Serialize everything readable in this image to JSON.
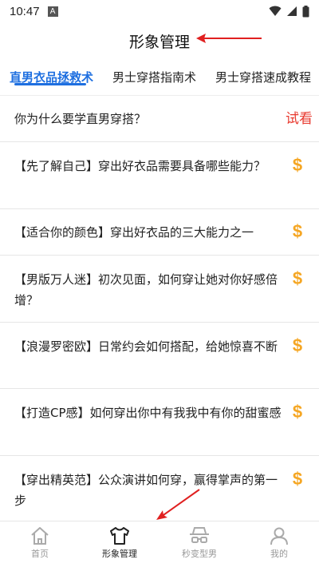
{
  "status_bar": {
    "time": "10:47",
    "notif_letter": "A"
  },
  "header": {
    "title": "形象管理"
  },
  "tabs": [
    {
      "label": "直男衣品拯救术",
      "active": true
    },
    {
      "label": "男士穿搭指南术",
      "active": false
    },
    {
      "label": "男士穿搭速成教程",
      "active": false
    }
  ],
  "intro": {
    "question": "你为什么要学直男穿搭？",
    "try_label": "试看"
  },
  "lessons": [
    {
      "text": "【先了解自己】穿出好衣品需要具备哪些能力？",
      "price_icon": "$"
    },
    {
      "text": "【适合你的颜色】穿出好衣品的三大能力之一",
      "price_icon": "$"
    },
    {
      "text": "【男版万人迷】初次见面，如何穿让她对你好感倍增？",
      "price_icon": "$"
    },
    {
      "text": "【浪漫罗密欧】日常约会如何搭配，给她惊喜不断",
      "price_icon": "$"
    },
    {
      "text": "【打造CP感】如何穿出你中有我我中有你的甜蜜感",
      "price_icon": "$"
    },
    {
      "text": "【穿出精英范】公众演讲如何穿，赢得掌声的第一步",
      "price_icon": "$"
    }
  ],
  "bottom_nav": [
    {
      "label": "首页",
      "icon": "home-icon",
      "active": false
    },
    {
      "label": "形象管理",
      "icon": "shirt-icon",
      "active": true
    },
    {
      "label": "秒变型男",
      "icon": "hat-glasses-icon",
      "active": false
    },
    {
      "label": "我的",
      "icon": "user-icon",
      "active": false
    }
  ],
  "colors": {
    "accent": "#1e6fe0",
    "try": "#e83a2f",
    "price": "#f5a623",
    "annotation_arrow": "#e02020"
  }
}
